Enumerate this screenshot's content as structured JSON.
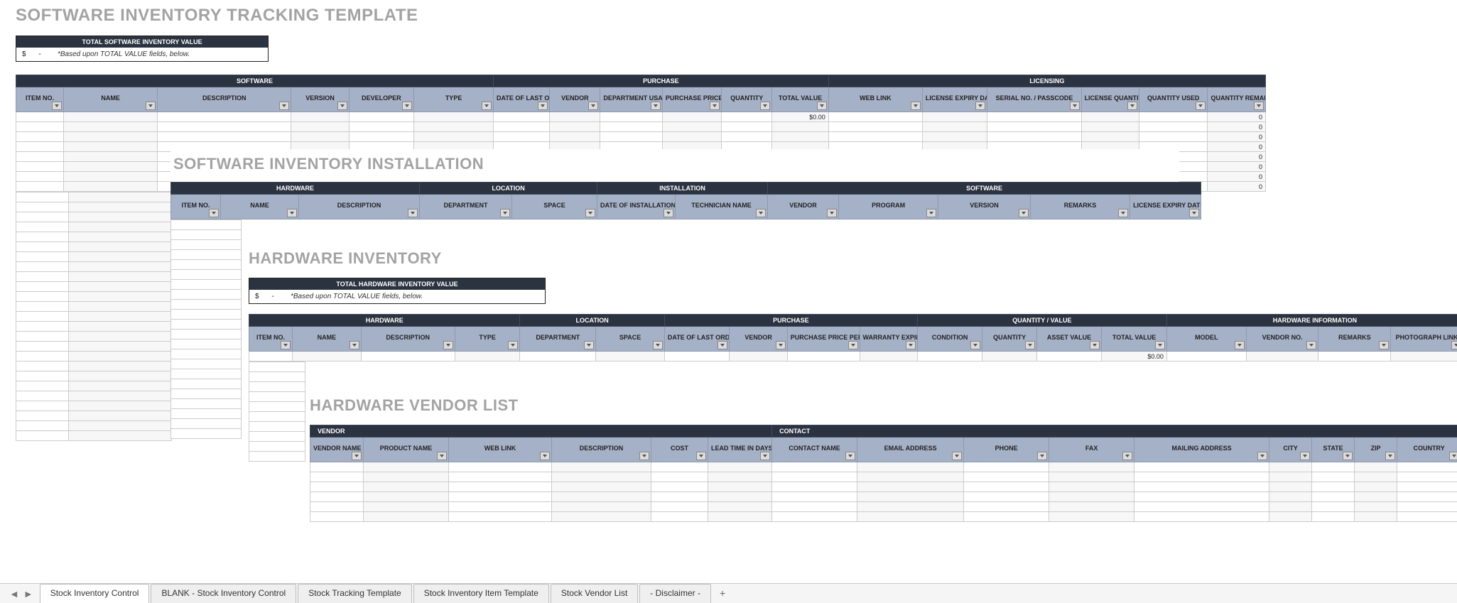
{
  "layers": {
    "software": {
      "title": "SOFTWARE INVENTORY TRACKING TEMPLATE",
      "totalbox": {
        "header": "TOTAL SOFTWARE INVENTORY VALUE",
        "currency": "$",
        "dash": "-",
        "note": "*Based upon TOTAL VALUE fields, below."
      },
      "groups": [
        {
          "label": "SOFTWARE",
          "span": 6
        },
        {
          "label": "PURCHASE",
          "span": 6
        },
        {
          "label": "LICENSING",
          "span": 6
        }
      ],
      "cols": [
        "ITEM NO.",
        "NAME",
        "DESCRIPTION",
        "VERSION",
        "DEVELOPER",
        "TYPE",
        "DATE OF LAST ORDER",
        "VENDOR",
        "DEPARTMENT USAGE",
        "PURCHASE PRICE PER ITEM",
        "QUANTITY",
        "TOTAL VALUE",
        "WEB LINK",
        "LICENSE EXPIRY DATE",
        "SERIAL NO. / PASSCODE",
        "LICENSE QUANTITY",
        "QUANTITY USED",
        "QUANTITY REMAINING"
      ],
      "totalval": "$0.00",
      "remain": "0"
    },
    "install": {
      "title": "SOFTWARE INVENTORY INSTALLATION",
      "groups": [
        {
          "label": "HARDWARE",
          "span": 3
        },
        {
          "label": "LOCATION",
          "span": 2
        },
        {
          "label": "INSTALLATION",
          "span": 2
        },
        {
          "label": "SOFTWARE",
          "span": 5
        }
      ],
      "cols": [
        "ITEM NO.",
        "NAME",
        "DESCRIPTION",
        "DEPARTMENT",
        "SPACE",
        "DATE OF INSTALLATION",
        "TECHNICIAN NAME",
        "VENDOR",
        "PROGRAM",
        "VERSION",
        "REMARKS",
        "LICENSE EXPIRY DATE"
      ]
    },
    "hardware": {
      "title": "HARDWARE INVENTORY",
      "totalbox": {
        "header": "TOTAL HARDWARE INVENTORY VALUE",
        "currency": "$",
        "dash": "-",
        "note": "*Based upon TOTAL VALUE fields, below."
      },
      "groups": [
        {
          "label": "HARDWARE",
          "span": 4
        },
        {
          "label": "LOCATION",
          "span": 2
        },
        {
          "label": "PURCHASE",
          "span": 4
        },
        {
          "label": "QUANTITY / VALUE",
          "span": 4
        },
        {
          "label": "HARDWARE INFORMATION",
          "span": 4
        }
      ],
      "cols": [
        "ITEM NO.",
        "NAME",
        "DESCRIPTION",
        "TYPE",
        "DEPARTMENT",
        "SPACE",
        "DATE OF LAST ORDER",
        "VENDOR",
        "PURCHASE PRICE PER ITEM",
        "WARRANTY EXPIRY DATE",
        "CONDITION",
        "QUANTITY",
        "ASSET VALUE",
        "TOTAL VALUE",
        "MODEL",
        "VENDOR NO.",
        "REMARKS",
        "PHOTOGRAPH LINK"
      ],
      "totalval": "$0.00"
    },
    "vendor": {
      "title": "HARDWARE VENDOR LIST",
      "groups": [
        {
          "label": "VENDOR",
          "span": 6
        },
        {
          "label": "CONTACT",
          "span": 8
        }
      ],
      "cols": [
        "VENDOR NAME",
        "PRODUCT NAME",
        "WEB LINK",
        "DESCRIPTION",
        "COST",
        "LEAD TIME IN DAYS",
        "CONTACT NAME",
        "EMAIL ADDRESS",
        "PHONE",
        "FAX",
        "MAILING ADDRESS",
        "CITY",
        "STATE",
        "ZIP",
        "COUNTRY"
      ]
    }
  },
  "tabs": [
    "Stock Inventory Control",
    "BLANK - Stock Inventory Control",
    "Stock Tracking Template",
    "Stock Inventory Item Template",
    "Stock Vendor List",
    "- Disclaimer -"
  ],
  "active_tab": 0
}
